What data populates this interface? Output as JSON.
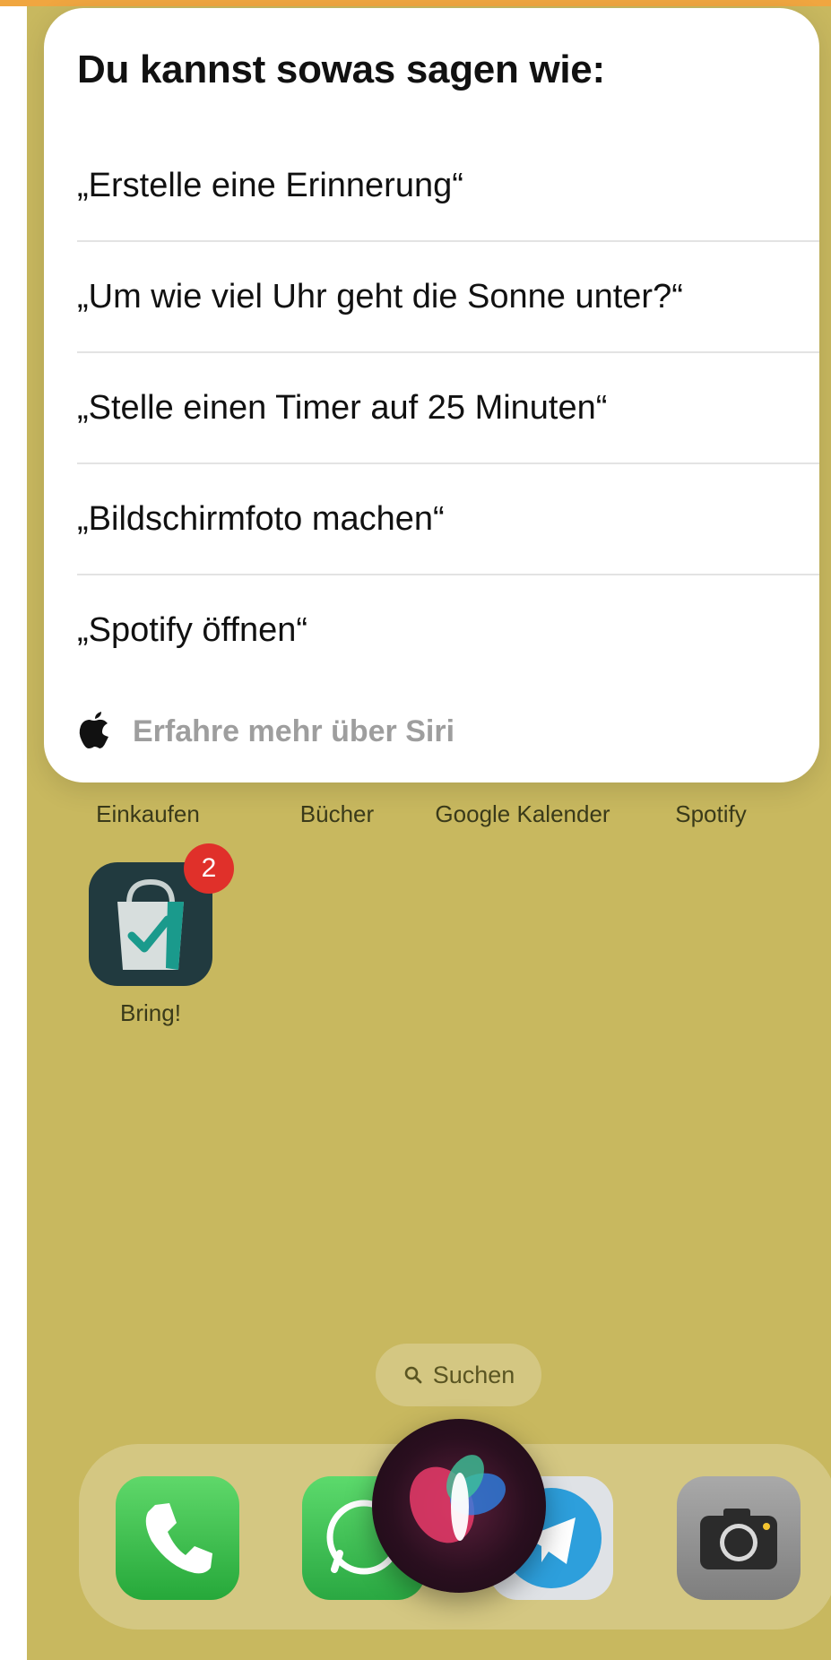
{
  "siri_card": {
    "title": "Du kannst sowas sagen wie:",
    "suggestions": [
      "„Erstelle eine Erinnerung“",
      "„Um wie viel Uhr geht die Sonne unter?“",
      "„Stelle einen Timer auf 25 Minuten“",
      "„Bildschirmfoto machen“",
      "„Spotify öffnen“"
    ],
    "learn_more": "Erfahre mehr über Siri",
    "learn_more_icon": "apple-logo-icon"
  },
  "home_screen": {
    "background_color": "#c8b85f",
    "app_labels": [
      "Einkaufen",
      "Bücher",
      "Google Kalender",
      "Spotify"
    ],
    "bring_app": {
      "label": "Bring!",
      "badge": "2",
      "icon": "shopping-bag-check-icon"
    },
    "search_pill": {
      "label": "Suchen",
      "icon": "search-icon"
    }
  },
  "dock": {
    "apps": [
      {
        "name": "Telefon",
        "icon": "phone-icon"
      },
      {
        "name": "WhatsApp",
        "icon": "whatsapp-icon"
      },
      {
        "name": "Telegram",
        "icon": "telegram-icon"
      },
      {
        "name": "Kamera",
        "icon": "camera-icon"
      }
    ]
  },
  "siri_orb": {
    "icon": "siri-orb-icon"
  }
}
